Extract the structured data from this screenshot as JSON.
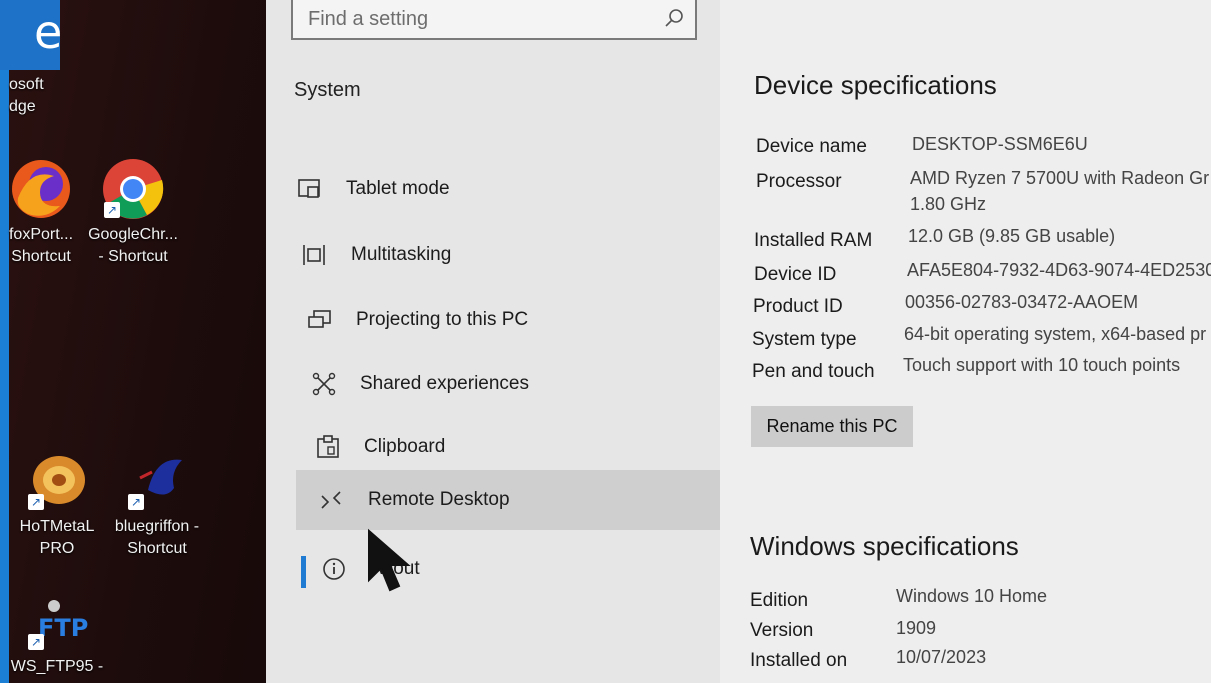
{
  "desktop": {
    "icons": [
      {
        "label_line1": "osoft",
        "label_line2": "dge"
      },
      {
        "label_line1": "foxPort...",
        "label_line2": "Shortcut"
      },
      {
        "label_line1": "GoogleChr...",
        "label_line2": "- Shortcut"
      },
      {
        "label_line1": "HoTMetaL",
        "label_line2": "PRO"
      },
      {
        "label_line1": "bluegriffon -",
        "label_line2": "Shortcut"
      },
      {
        "label_line1": "WS_FTP95 -",
        "label_line2": ""
      }
    ]
  },
  "settings": {
    "search": {
      "placeholder": "Find a setting"
    },
    "nav_heading": "System",
    "nav_items": [
      {
        "label": "Tablet mode",
        "icon": "tablet-mode-icon"
      },
      {
        "label": "Multitasking",
        "icon": "multitasking-icon"
      },
      {
        "label": "Projecting to this PC",
        "icon": "projecting-icon"
      },
      {
        "label": "Shared experiences",
        "icon": "shared-experiences-icon"
      },
      {
        "label": "Clipboard",
        "icon": "clipboard-icon"
      },
      {
        "label": "Remote Desktop",
        "icon": "remote-desktop-icon"
      },
      {
        "label": "About",
        "icon": "info-icon"
      }
    ],
    "selected_item": "Remote Desktop",
    "active_item": "About"
  },
  "device_specs": {
    "title": "Device specifications",
    "rows": [
      {
        "label": "Device name",
        "value": "DESKTOP-SSM6E6U"
      },
      {
        "label": "Processor",
        "value": "AMD Ryzen 7 5700U with Radeon Gr",
        "value2": "1.80 GHz"
      },
      {
        "label": "Installed RAM",
        "value": "12.0 GB (9.85 GB usable)"
      },
      {
        "label": "Device ID",
        "value": "AFA5E804-7932-4D63-9074-4ED2530"
      },
      {
        "label": "Product ID",
        "value": "00356-02783-03472-AAOEM"
      },
      {
        "label": "System type",
        "value": "64-bit operating system, x64-based pr"
      },
      {
        "label": "Pen and touch",
        "value": "Touch support with 10 touch points"
      }
    ],
    "rename_button": "Rename this PC"
  },
  "windows_specs": {
    "title": "Windows specifications",
    "rows": [
      {
        "label": "Edition",
        "value": "Windows 10 Home"
      },
      {
        "label": "Version",
        "value": "1909"
      },
      {
        "label": "Installed on",
        "value": "10/07/2023"
      }
    ]
  },
  "colors": {
    "accent": "#1f7ad1",
    "nav_background": "#e6e6e6",
    "content_background": "#eeeeee",
    "selected_background": "#cfcfcf"
  }
}
